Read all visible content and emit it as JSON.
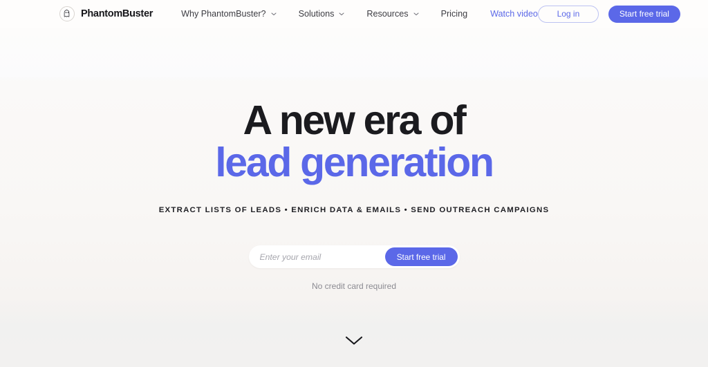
{
  "brand": {
    "name": "PhantomBuster",
    "logo_icon": "ghost-icon"
  },
  "nav": {
    "items": [
      {
        "label": "Why PhantomBuster?",
        "has_dropdown": true,
        "icon": "chevron-down-icon"
      },
      {
        "label": "Solutions",
        "has_dropdown": true,
        "icon": "chevron-down-icon"
      },
      {
        "label": "Resources",
        "has_dropdown": true,
        "icon": "chevron-down-icon"
      },
      {
        "label": "Pricing",
        "has_dropdown": false
      }
    ],
    "watch_video_label": "Watch video",
    "login_label": "Log in",
    "trial_label": "Start free trial"
  },
  "hero": {
    "headline_line1": "A new era of",
    "headline_line2": "lead generation",
    "tagline": "EXTRACT LISTS OF LEADS • ENRICH DATA & EMAILS • SEND OUTREACH CAMPAIGNS",
    "email_placeholder": "Enter your email",
    "email_value": "",
    "cta_label": "Start free trial",
    "note": "No credit card required",
    "scroll_icon": "chevron-down-icon"
  },
  "colors": {
    "accent": "#5b68e8",
    "headline_dark": "#1b1b1f",
    "page_bg_top": "#fdfcfb",
    "page_bg_bottom": "#f2f1f0",
    "note_text": "#8b8b92"
  }
}
